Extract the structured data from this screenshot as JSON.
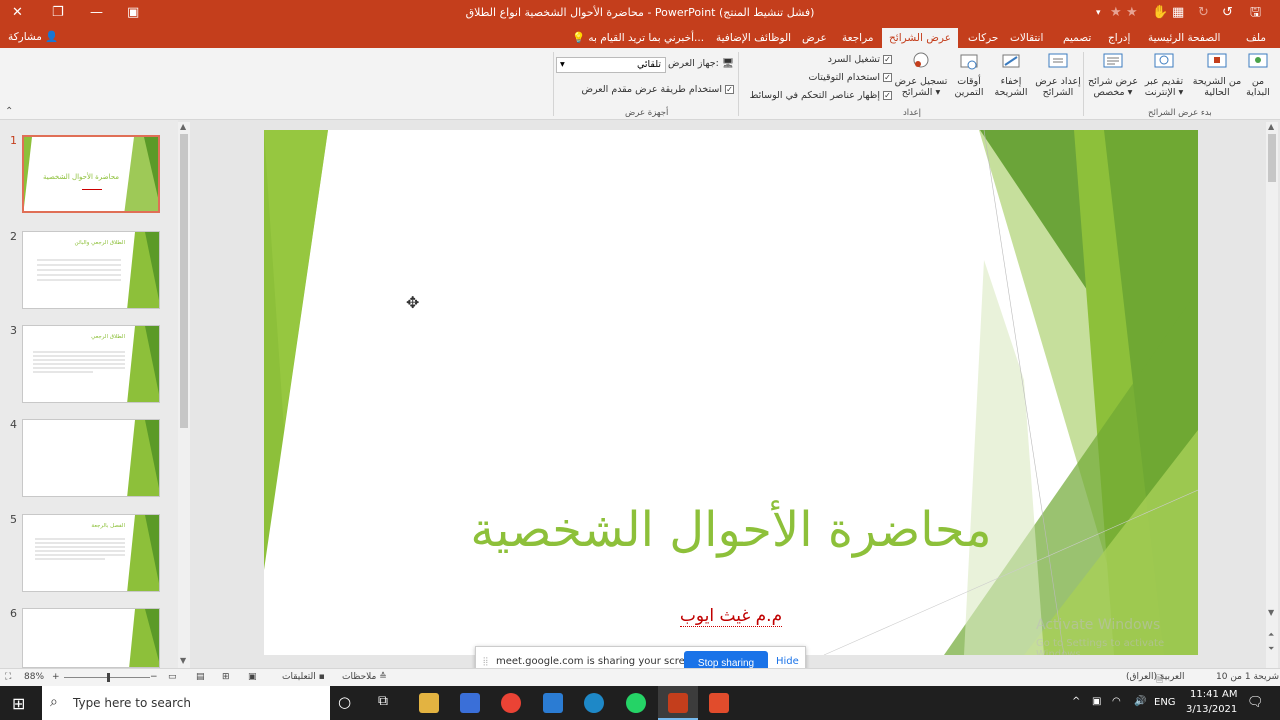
{
  "window": {
    "title": "محاضرة الأحوال الشخصية انواع الطلاق - PowerPoint (فشل تنشيط المنتج)",
    "share_label": "مشاركة"
  },
  "tabs": [
    "ملف",
    "الصفحة الرئيسية",
    "إدراج",
    "تصميم",
    "انتقالات",
    "حركات",
    "عرض الشرائح",
    "مراجعة",
    "عرض",
    "الوظائف الإضافية"
  ],
  "active_tab": "عرض الشرائح",
  "tell_me": "أخبرني بما تريد القيام به...",
  "ribbon": {
    "start_group": {
      "label": "بدء عرض الشرائح",
      "buttons": [
        {
          "line1": "من",
          "line2": "البداية"
        },
        {
          "line1": "من الشريحة",
          "line2": "الحالية"
        },
        {
          "line1": "تقديم عبر",
          "line2": "الإنترنت ▾"
        },
        {
          "line1": "عرض شرائح",
          "line2": "مخصص ▾"
        }
      ]
    },
    "setup_group": {
      "label": "إعداد",
      "buttons": [
        {
          "line1": "إعداد عرض",
          "line2": "الشرائح"
        },
        {
          "line1": "إخفاء",
          "line2": "الشريحة"
        },
        {
          "line1": "أوقات",
          "line2": "التمرين"
        },
        {
          "line1": "تسجيل عرض",
          "line2": "الشرائح ▾"
        }
      ],
      "checks": [
        {
          "label": "تشغيل السرد",
          "checked": true
        },
        {
          "label": "استخدام التوقيتات",
          "checked": true
        },
        {
          "label": "إظهار عناصر التحكم في الوسائط",
          "checked": true
        }
      ]
    },
    "monitors_group": {
      "label": "أجهزة عرض",
      "monitor_label": "جهاز العرض:",
      "monitor_value": "تلقائي",
      "presenter_check": "استخدام طريقة عرض مقدم العرض",
      "presenter_checked": true
    }
  },
  "thumbnails": [
    {
      "num": "1",
      "title": "محاضرة الأحوال الشخصية",
      "selected": true
    },
    {
      "num": "2",
      "title": "الطلاق الرجعي والبائن",
      "selected": false
    },
    {
      "num": "3",
      "title": "الطلاق الرجعي",
      "selected": false
    },
    {
      "num": "4",
      "title": "",
      "selected": false
    },
    {
      "num": "5",
      "title": "الفصل بالرجعة",
      "selected": false
    },
    {
      "num": "6",
      "title": "",
      "selected": false
    }
  ],
  "slide": {
    "title": "محاضرة الأحوال الشخصية",
    "subtitle": "م.م غيث ايوب"
  },
  "share_bar": {
    "message": "meet.google.com is sharing your screen.",
    "stop_label": "Stop sharing",
    "hide_label": "Hide"
  },
  "watermark": {
    "line1": "Activate Windows",
    "line2": "Go to Settings to activate Windows."
  },
  "status": {
    "slide_info": "شريحة 1 من 10",
    "language": "العربية (العراق)",
    "notes": "ملاحظات",
    "comments": "التعليقات",
    "zoom": "88%"
  },
  "taskbar": {
    "search_placeholder": "Type here to search",
    "time": "11:41 AM",
    "date": "3/13/2021",
    "lang": "ENG"
  },
  "colors": {
    "accent": "#c43e1c",
    "slide_green": "#8dc03a",
    "subtitle_red": "#c00000"
  }
}
